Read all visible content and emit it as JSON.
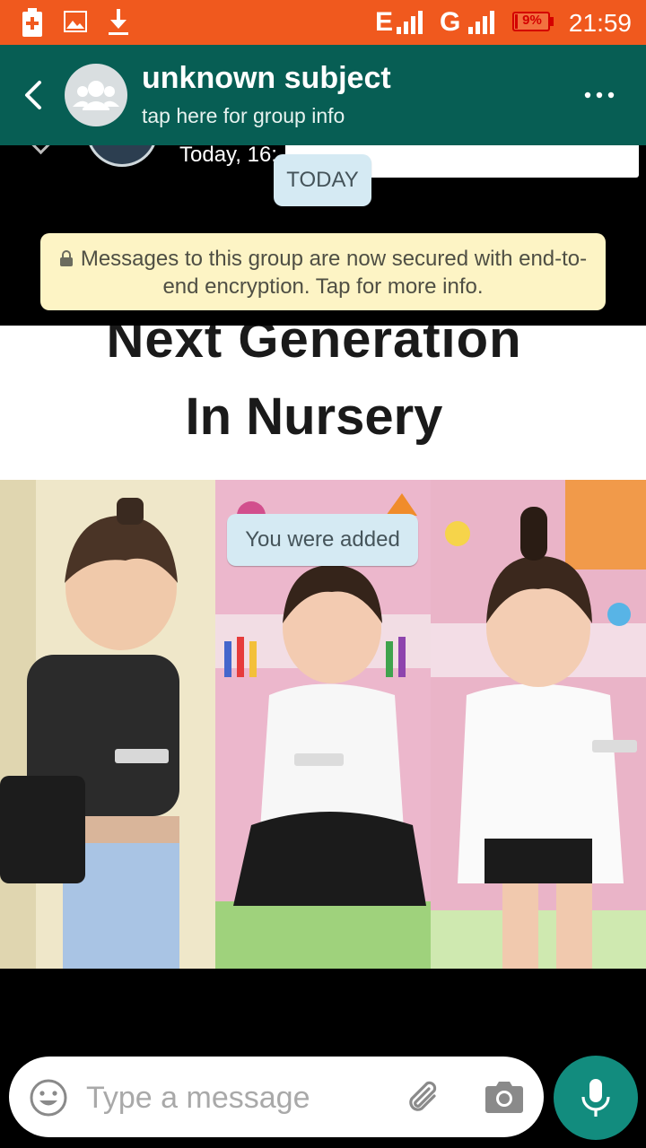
{
  "status_bar": {
    "network_e": "E",
    "network_g": "G",
    "battery": "9%",
    "battery_level": 0.09,
    "time": "21:59",
    "icons": [
      "battery-saver-icon",
      "image-icon",
      "download-icon",
      "signal-icon"
    ]
  },
  "header": {
    "title": "unknown subject",
    "subtitle": "tap here for group info",
    "icons": [
      "back-arrow-icon",
      "group-avatar-icon",
      "more-vert-icon"
    ]
  },
  "chat": {
    "peek_time": "Today, 16:",
    "date_divider": "TODAY",
    "encryption_notice": "Messages to this group are now secured with end-to-end encryption. Tap for more info.",
    "image_caption_line1": "Next Generation",
    "image_caption_line2": "In Nursery",
    "system_message": "You were added"
  },
  "composer": {
    "placeholder": "Type a message",
    "value": "",
    "icons": [
      "emoji-icon",
      "attach-icon",
      "camera-icon",
      "mic-icon"
    ]
  },
  "colors": {
    "status_bar": "#f0591e",
    "header": "#075e54",
    "notice_bg": "#fdf4c5",
    "pill_bg": "#d5eaf3",
    "mic_button": "#128c7e"
  }
}
